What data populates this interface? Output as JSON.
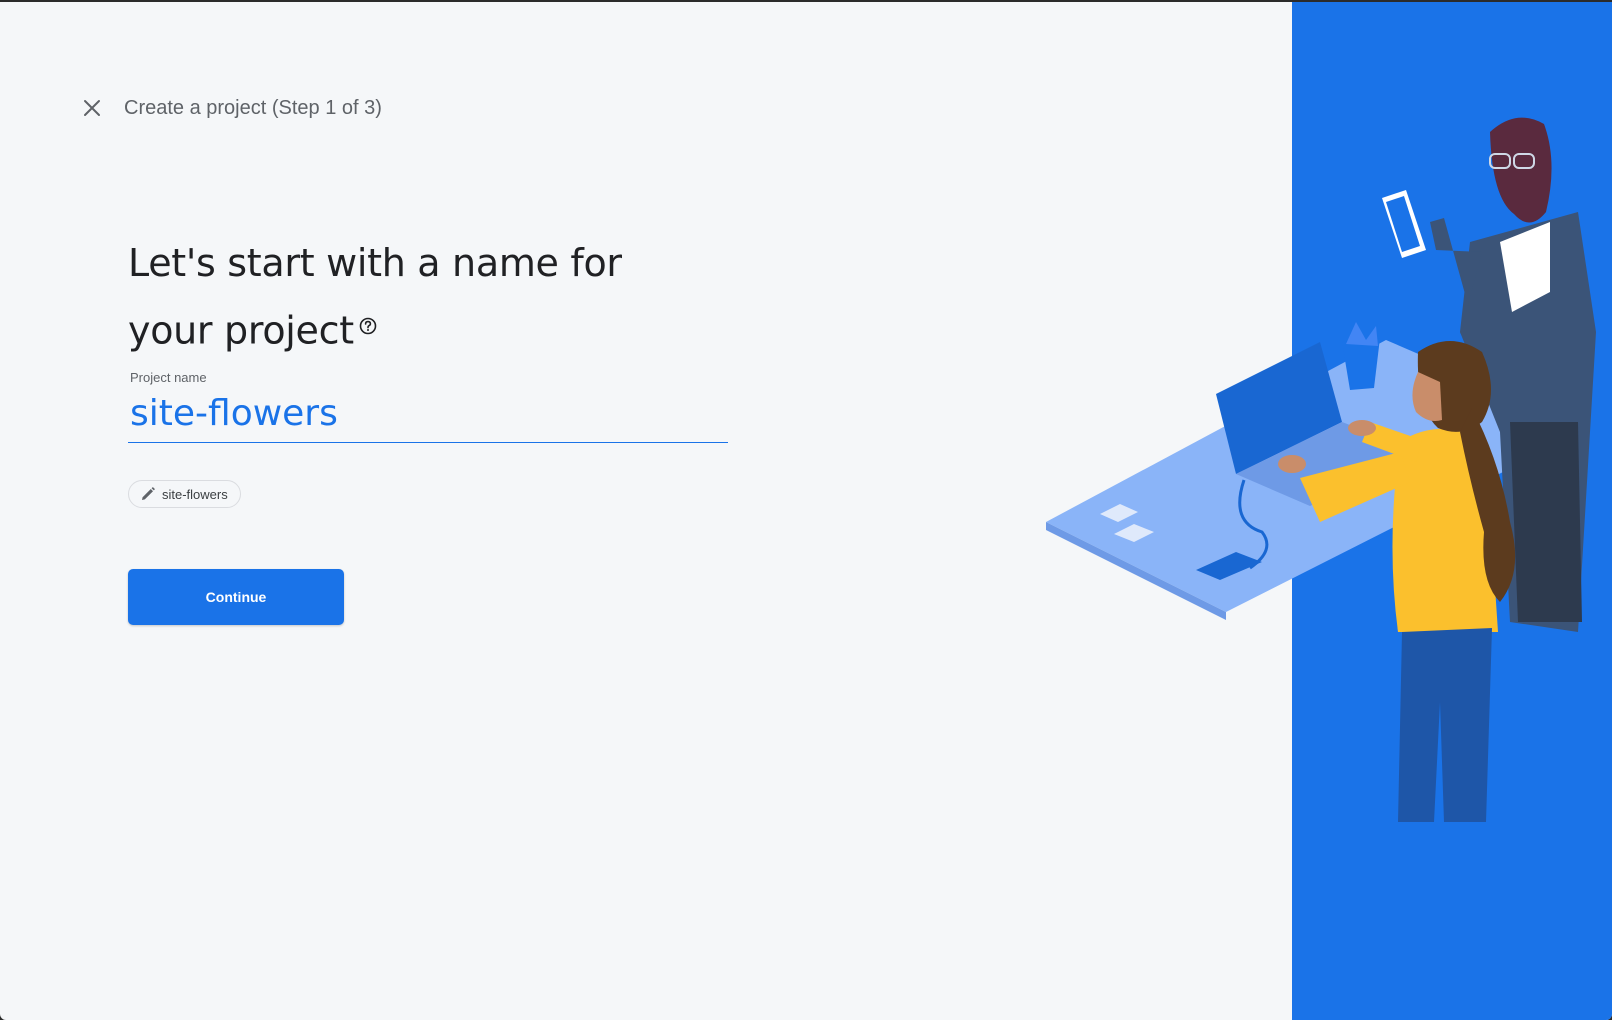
{
  "header": {
    "close_icon": "close-icon",
    "title": "Create a project (Step 1 of 3)"
  },
  "heading": {
    "line1": "Let's start with a name for",
    "line2": "your project",
    "help_icon": "help-circle-icon"
  },
  "project_name": {
    "label": "Project name",
    "value": "site-flowers"
  },
  "project_id_chip": {
    "icon": "pencil-icon",
    "label": "site-flowers"
  },
  "continue_button": {
    "label": "Continue"
  },
  "colors": {
    "accent": "#1a73e8",
    "background": "#f5f7f9",
    "heading": "#202124"
  }
}
